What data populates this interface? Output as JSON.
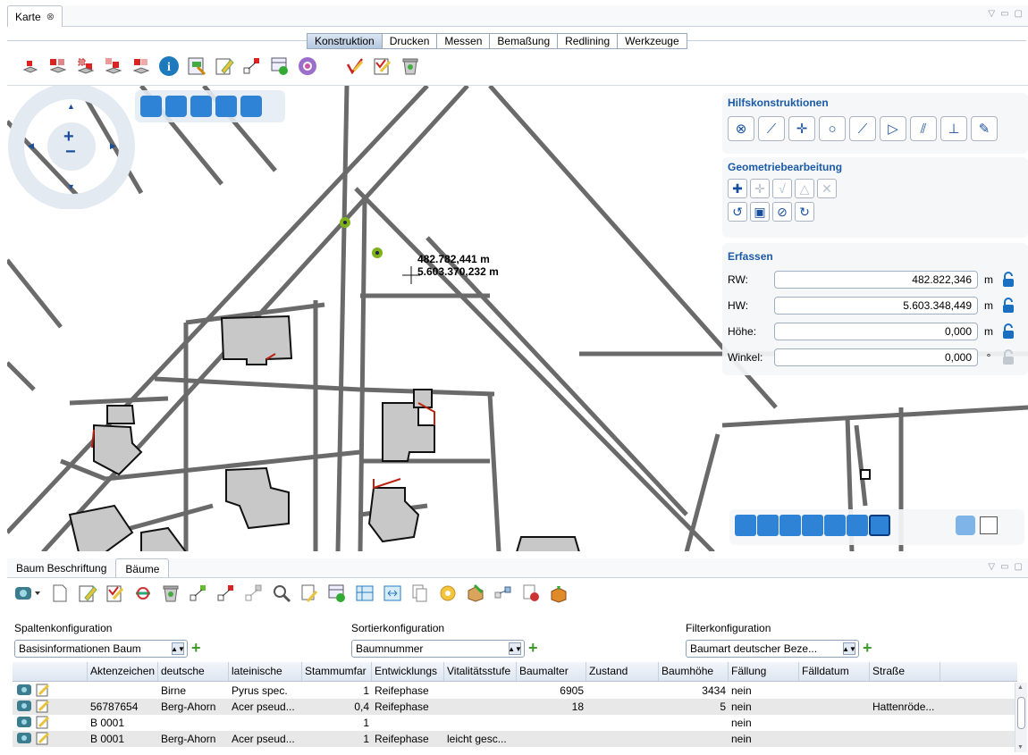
{
  "view": {
    "title": "Karte",
    "close": "⊗"
  },
  "tabs": [
    "Konstruktion",
    "Drucken",
    "Messen",
    "Bemaßung",
    "Redlining",
    "Werkzeuge"
  ],
  "active_tab": "Konstruktion",
  "map": {
    "coord_rw": "482.782,441 m",
    "coord_hw": "5.603.370,232 m"
  },
  "hilfs": {
    "title": "Hilfskonstruktionen"
  },
  "geo": {
    "title": "Geometriebearbeitung"
  },
  "erfassen": {
    "title": "Erfassen",
    "rw_label": "RW:",
    "rw_value": "482.822,346",
    "rw_unit": "m",
    "hw_label": "HW:",
    "hw_value": "5.603.348,449",
    "hw_unit": "m",
    "hoehe_label": "Höhe:",
    "hoehe_value": "0,000",
    "hoehe_unit": "m",
    "winkel_label": "Winkel:",
    "winkel_value": "0,000",
    "winkel_unit": "°"
  },
  "bottom": {
    "tabs": [
      "Baum Beschriftung",
      "Bäume"
    ],
    "active_tab": "Bäume",
    "spalten_label": "Spaltenkonfiguration",
    "spalten_value": "Basisinformationen Baum",
    "sortier_label": "Sortierkonfiguration",
    "sortier_value": "Baumnummer",
    "filter_label": "Filterkonfiguration",
    "filter_value": "Baumart deutscher Beze..."
  },
  "table": {
    "columns": [
      "",
      "Aktenzeichen",
      "deutsche",
      "lateinische",
      "Stammumfar",
      "Entwicklungs",
      "Vitalitätsstufe",
      "Baumalter",
      "Zustand",
      "Baumhöhe",
      "Fällung",
      "Fälldatum",
      "Straße"
    ],
    "rows": [
      [
        "",
        "",
        "Birne",
        "Pyrus  spec.",
        "1",
        "Reifephase",
        "",
        "6905",
        "",
        "3434",
        "nein",
        "",
        ""
      ],
      [
        "",
        "56787654",
        "Berg-Ahorn",
        "Acer pseud...",
        "0,4",
        "Reifephase",
        "",
        "18",
        "",
        "5",
        "nein",
        "",
        "Hattenröde..."
      ],
      [
        "",
        "B 0001",
        "",
        "",
        "1",
        "",
        "",
        "",
        "",
        "",
        "nein",
        "",
        ""
      ],
      [
        "",
        "B 0001",
        "Berg-Ahorn",
        "Acer pseud...",
        "1",
        "Reifephase",
        "leicht gesc...",
        "",
        "",
        "",
        "nein",
        "",
        ""
      ]
    ]
  }
}
